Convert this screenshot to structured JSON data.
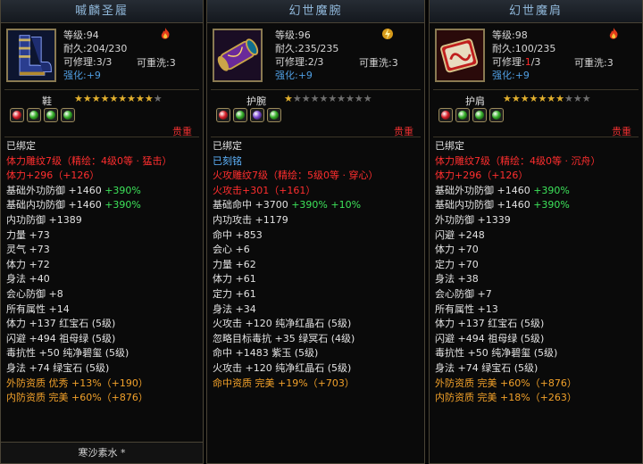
{
  "panels": [
    {
      "title": "嘁麟圣履",
      "level": "等级:94",
      "durability": "耐久:204/230",
      "repairable": "可修理:3/3",
      "rewash": "可重洗:3",
      "enhance_label": "强化:",
      "enhance_value": "+9",
      "slot_name": "鞋",
      "stars_on": "★★★★★★★★★",
      "stars_off": "★",
      "quality": "贵重",
      "icon": "boots-icon",
      "gems": [
        "#d8202a",
        "#36b02a",
        "#36b02a",
        "#36b02a"
      ],
      "attrs": [
        {
          "text": "已绑定",
          "color": "white"
        },
        {
          "text": "体力雕纹7级（精绘：4级0等 · 猛击）",
          "color": "red"
        },
        {
          "text": "体力+296（+126）",
          "color": "red"
        },
        {
          "segments": [
            {
              "text": "基础外功防御 +1460 ",
              "color": "white"
            },
            {
              "text": "+390%",
              "color": "green"
            }
          ]
        },
        {
          "segments": [
            {
              "text": "基础内功防御 +1460 ",
              "color": "white"
            },
            {
              "text": "+390%",
              "color": "green"
            }
          ]
        },
        {
          "text": "内功防御 +1389",
          "color": "white"
        },
        {
          "text": "力量 +73",
          "color": "white"
        },
        {
          "text": "灵气 +73",
          "color": "white"
        },
        {
          "text": "体力 +72",
          "color": "white"
        },
        {
          "text": "身法 +40",
          "color": "white"
        },
        {
          "text": "会心防御 +8",
          "color": "white"
        },
        {
          "text": "所有属性 +14",
          "color": "white"
        },
        {
          "text": "体力 +137 红宝石 (5级)",
          "color": "white"
        },
        {
          "text": "闪避 +494 祖母绿 (5级)",
          "color": "white"
        },
        {
          "text": "毒抗性 +50 纯净碧玺 (5级)",
          "color": "white"
        },
        {
          "text": "身法 +74 绿宝石 (5级)",
          "color": "white"
        },
        {
          "text": "外防资质   优秀 +13%（+190）",
          "color": "orange"
        },
        {
          "text": "内防资质   完美 +60%（+876）",
          "color": "orange"
        }
      ],
      "footer": "寒沙素水 *"
    },
    {
      "title": "幻世魔腕",
      "level": "等级:96",
      "durability": "耐久:235/235",
      "repairable": "可修理:2/3",
      "rewash": "可重洗:3",
      "enhance_label": "强化:",
      "enhance_value": "+9",
      "slot_name": "护腕",
      "stars_on": "★",
      "stars_off": "★★★★★★★★★",
      "quality": "贵重",
      "icon": "bracer-icon",
      "gems": [
        "#d8202a",
        "#36b02a",
        "#7a48d0",
        "#36b02a"
      ],
      "attrs": [
        {
          "text": "已绑定",
          "color": "white"
        },
        {
          "text": "已刻铭",
          "color": "cyan"
        },
        {
          "text": "火攻雕纹7级（精绘：5级0等 · 穿心）",
          "color": "red"
        },
        {
          "text": "火攻击+301（+161）",
          "color": "red"
        },
        {
          "segments": [
            {
              "text": "基础命中 +3700 ",
              "color": "white"
            },
            {
              "text": "+390% +10%",
              "color": "green"
            }
          ]
        },
        {
          "text": "内功攻击 +1179",
          "color": "white"
        },
        {
          "text": "命中 +853",
          "color": "white"
        },
        {
          "text": "会心 +6",
          "color": "white"
        },
        {
          "text": "力量 +62",
          "color": "white"
        },
        {
          "text": "体力 +61",
          "color": "white"
        },
        {
          "text": "定力 +61",
          "color": "white"
        },
        {
          "text": "身法 +34",
          "color": "white"
        },
        {
          "text": "火攻击 +120 纯净红晶石 (5级)",
          "color": "white"
        },
        {
          "text": "忽略目标毒抗 +35 绿冥石 (4级)",
          "color": "white"
        },
        {
          "text": "命中 +1483 紫玉 (5级)",
          "color": "white"
        },
        {
          "text": "火攻击 +120 纯净红晶石 (5级)",
          "color": "white"
        },
        {
          "text": "命中资质   完美 +19%（+703）",
          "color": "orange"
        }
      ],
      "footer": ""
    },
    {
      "title": "幻世魔肩",
      "level": "等级:98",
      "durability": "耐久:100/235",
      "repairable_prefix": "可修理:",
      "repairable_low": "1",
      "repairable_suffix": "/3",
      "rewash": "可重洗:3",
      "enhance_label": "强化:",
      "enhance_value": "+9",
      "slot_name": "护肩",
      "stars_on": "★★★★★★★",
      "stars_off": "★★★",
      "quality": "贵重",
      "icon": "shoulder-guard-icon",
      "gems": [
        "#d8202a",
        "#36b02a",
        "#36b02a",
        "#36b02a"
      ],
      "attrs": [
        {
          "text": "已绑定",
          "color": "white"
        },
        {
          "text": "体力雕纹7级（精绘：4级0等 · 沉舟）",
          "color": "red"
        },
        {
          "text": "体力+296（+126）",
          "color": "red"
        },
        {
          "segments": [
            {
              "text": "基础外功防御 +1460 ",
              "color": "white"
            },
            {
              "text": "+390%",
              "color": "green"
            }
          ]
        },
        {
          "segments": [
            {
              "text": "基础内功防御 +1460 ",
              "color": "white"
            },
            {
              "text": "+390%",
              "color": "green"
            }
          ]
        },
        {
          "text": "外功防御 +1339",
          "color": "white"
        },
        {
          "text": "闪避 +248",
          "color": "white"
        },
        {
          "text": "体力 +70",
          "color": "white"
        },
        {
          "text": "定力 +70",
          "color": "white"
        },
        {
          "text": "身法 +38",
          "color": "white"
        },
        {
          "text": "会心防御 +7",
          "color": "white"
        },
        {
          "text": "所有属性 +13",
          "color": "white"
        },
        {
          "text": "体力 +137 红宝石 (5级)",
          "color": "white"
        },
        {
          "text": "闪避 +494 祖母绿 (5级)",
          "color": "white"
        },
        {
          "text": "毒抗性 +50 纯净碧玺 (5级)",
          "color": "white"
        },
        {
          "text": "身法 +74 绿宝石 (5级)",
          "color": "white"
        },
        {
          "text": "外防资质   完美 +60%（+876）",
          "color": "orange"
        },
        {
          "text": "内防资质   完美 +18%（+263）",
          "color": "orange"
        }
      ],
      "footer": ""
    }
  ],
  "colors": {
    "title": "#8fb6d8",
    "enhance": "#4f9de0",
    "quality": "#e83030",
    "white": "#e2e2e2",
    "red": "#ff2e2e",
    "green": "#3de35a",
    "orange": "#f2a12a",
    "cyan": "#5fb5ff"
  }
}
